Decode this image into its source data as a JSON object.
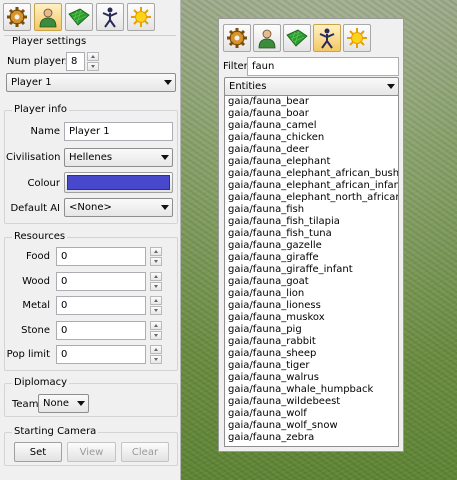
{
  "colors": {
    "player_colour": "#4848cc",
    "panel_bg": "#f0f0f0",
    "active_tool": "#f3c866"
  },
  "toolbar_left": [
    {
      "icon": "gear-icon"
    },
    {
      "icon": "player-icon",
      "active": true
    },
    {
      "icon": "terrain-icon"
    },
    {
      "icon": "unit-icon"
    },
    {
      "icon": "sun-icon"
    }
  ],
  "player_settings": {
    "title": "Player settings",
    "num_players_label": "Num players",
    "num_players_value": "8",
    "player_select": "Player 1"
  },
  "player_info": {
    "title": "Player info",
    "name_label": "Name",
    "name_value": "Player 1",
    "civ_label": "Civilisation",
    "civ_value": "Hellenes",
    "colour_label": "Colour",
    "ai_label": "Default AI",
    "ai_value": "<None>"
  },
  "resources": {
    "title": "Resources",
    "rows": [
      {
        "label": "Food",
        "value": "0"
      },
      {
        "label": "Wood",
        "value": "0"
      },
      {
        "label": "Metal",
        "value": "0"
      },
      {
        "label": "Stone",
        "value": "0"
      },
      {
        "label": "Pop limit",
        "value": "0"
      }
    ]
  },
  "diplomacy": {
    "title": "Diplomacy",
    "team_label": "Team",
    "team_value": "None"
  },
  "camera": {
    "title": "Starting Camera",
    "set": "Set",
    "view": "View",
    "clear": "Clear"
  },
  "object_panel": {
    "filter_label": "Filter",
    "filter_value": "faun",
    "type_select": "Entities",
    "items": [
      "gaia/fauna_bear",
      "gaia/fauna_boar",
      "gaia/fauna_camel",
      "gaia/fauna_chicken",
      "gaia/fauna_deer",
      "gaia/fauna_elephant",
      "gaia/fauna_elephant_african_bush",
      "gaia/fauna_elephant_african_infant",
      "gaia/fauna_elephant_north_african",
      "gaia/fauna_fish",
      "gaia/fauna_fish_tilapia",
      "gaia/fauna_fish_tuna",
      "gaia/fauna_gazelle",
      "gaia/fauna_giraffe",
      "gaia/fauna_giraffe_infant",
      "gaia/fauna_goat",
      "gaia/fauna_lion",
      "gaia/fauna_lioness",
      "gaia/fauna_muskox",
      "gaia/fauna_pig",
      "gaia/fauna_rabbit",
      "gaia/fauna_sheep",
      "gaia/fauna_tiger",
      "gaia/fauna_walrus",
      "gaia/fauna_whale_humpback",
      "gaia/fauna_wildebeest",
      "gaia/fauna_wolf",
      "gaia/fauna_wolf_snow",
      "gaia/fauna_zebra"
    ]
  }
}
